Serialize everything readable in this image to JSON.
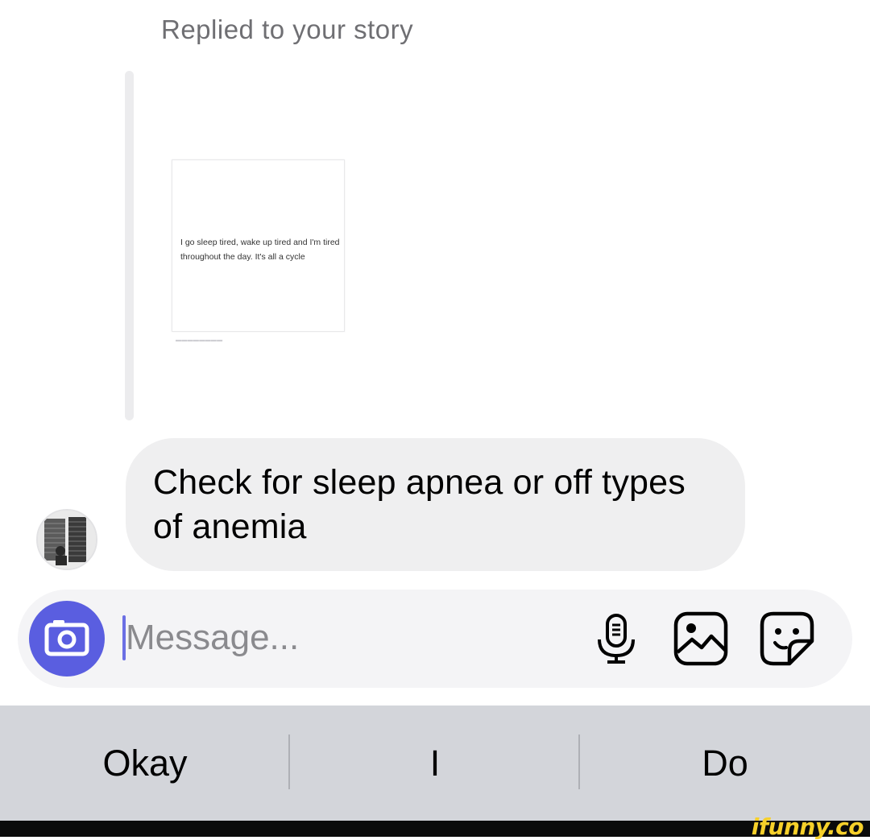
{
  "reply": {
    "header": "Replied to your story",
    "story_text": "I go sleep tired, wake up tired and I'm tired throughout the day. It's all a cycle"
  },
  "message": {
    "text": "Check for sleep apnea or off types of anemia"
  },
  "composer": {
    "placeholder": "Message...",
    "camera_icon": "camera-icon",
    "mic_icon": "microphone-icon",
    "gallery_icon": "gallery-icon",
    "sticker_icon": "sticker-icon",
    "accent_color": "#5a5ee0"
  },
  "keyboard_suggestions": [
    "Okay",
    "I",
    "Do"
  ],
  "watermark": "ifunny.co"
}
